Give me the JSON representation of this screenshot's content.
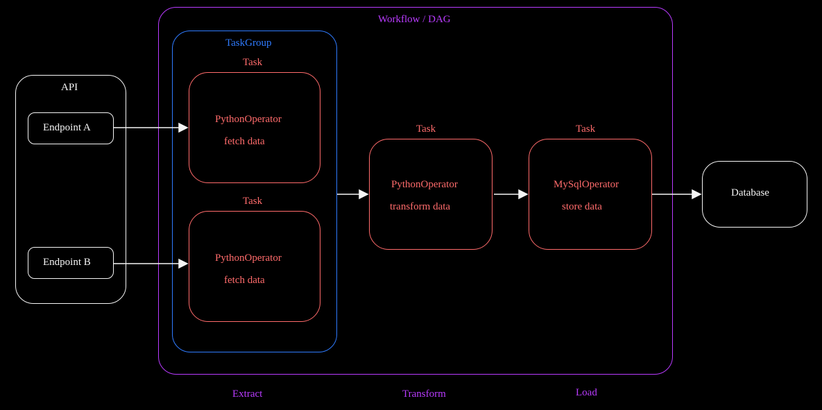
{
  "api": {
    "title": "API",
    "endpoints": [
      "Endpoint A",
      "Endpoint B"
    ]
  },
  "workflow": {
    "title": "Workflow / DAG",
    "taskgroup": {
      "title": "TaskGroup",
      "tasks": [
        {
          "label": "Task",
          "operator": "PythonOperator",
          "action": "fetch data"
        },
        {
          "label": "Task",
          "operator": "PythonOperator",
          "action": "fetch data"
        }
      ]
    },
    "transform": {
      "label": "Task",
      "operator": "PythonOperator",
      "action": "transform data"
    },
    "load": {
      "label": "Task",
      "operator": "MySqlOperator",
      "action": "store data"
    },
    "phases": [
      "Extract",
      "Transform",
      "Load"
    ]
  },
  "database": {
    "title": "Database"
  }
}
